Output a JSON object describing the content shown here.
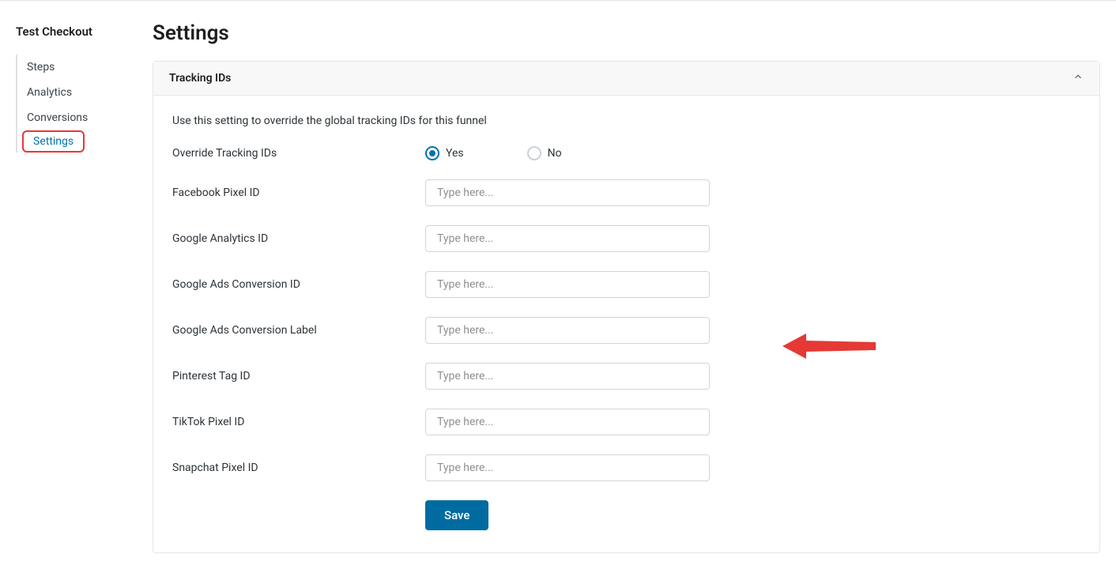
{
  "sidebar": {
    "title": "Test Checkout",
    "items": [
      {
        "label": "Steps"
      },
      {
        "label": "Analytics"
      },
      {
        "label": "Conversions"
      },
      {
        "label": "Settings"
      }
    ]
  },
  "page": {
    "title": "Settings"
  },
  "panel": {
    "title": "Tracking IDs",
    "help_text": "Use this setting to override the global tracking IDs for this funnel",
    "override_label": "Override Tracking IDs",
    "yes_label": "Yes",
    "no_label": "No",
    "fields": {
      "facebook_pixel": {
        "label": "Facebook Pixel ID",
        "placeholder": "Type here...",
        "value": ""
      },
      "google_analytics": {
        "label": "Google Analytics ID",
        "placeholder": "Type here...",
        "value": ""
      },
      "google_ads_conversion_id": {
        "label": "Google Ads Conversion ID",
        "placeholder": "Type here...",
        "value": ""
      },
      "google_ads_conversion_label": {
        "label": "Google Ads Conversion Label",
        "placeholder": "Type here...",
        "value": ""
      },
      "pinterest_tag": {
        "label": "Pinterest Tag ID",
        "placeholder": "Type here...",
        "value": ""
      },
      "tiktok_pixel": {
        "label": "TikTok Pixel ID",
        "placeholder": "Type here...",
        "value": ""
      },
      "snapchat_pixel": {
        "label": "Snapchat Pixel ID",
        "placeholder": "Type here...",
        "value": ""
      }
    },
    "save_label": "Save"
  }
}
